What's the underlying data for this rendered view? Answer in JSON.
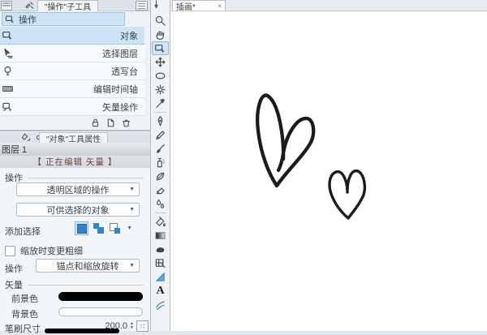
{
  "panel_tabs": {
    "subtool_tab": "\"操作\"子工具",
    "property_tab": "\"对象\"工具属性"
  },
  "subtool": {
    "group_tab": "操作",
    "items": [
      {
        "label": "对象",
        "icon": "object-icon",
        "selected": true
      },
      {
        "label": "选择图层",
        "icon": "select-layer-icon",
        "selected": false
      },
      {
        "label": "透写台",
        "icon": "light-table-icon",
        "selected": false
      },
      {
        "label": "编辑时间轴",
        "icon": "timeline-icon",
        "selected": false
      },
      {
        "label": "矢量操作",
        "icon": "vector-icon",
        "selected": false
      }
    ]
  },
  "property": {
    "layer_name": "图层 1",
    "editing_status": "【 正在编辑 矢量 】",
    "section_operation": "操作",
    "dropdown_transparent_area": "透明区域的操作",
    "dropdown_selectable_objects": "可供选择的对象",
    "add_selection_label": "添加选择",
    "scale_checkbox_label": "缩放时变更粗细",
    "operation_label": "操作",
    "dropdown_anchor_scale": "锚点和缩放旋转",
    "section_vector": "矢量",
    "foreground_label": "前景色",
    "background_label": "背景色",
    "foreground_color": "#000000",
    "background_color": "#ffffff",
    "brush_size_label": "笔刷尺寸",
    "brush_size_value": "200.0"
  },
  "toolbar": {
    "selected_tool": "operation-tool",
    "tools": [
      {
        "name": "zoom-tool",
        "icon": "magnifier-icon"
      },
      {
        "name": "hand-tool",
        "icon": "hand-icon"
      },
      {
        "name": "operation-tool",
        "icon": "object-icon"
      },
      {
        "name": "layer-move-tool",
        "icon": "move-icon"
      },
      {
        "name": "selection-tool",
        "icon": "ellipse-select-icon"
      },
      {
        "name": "auto-select-tool",
        "icon": "magic-wand-icon"
      },
      {
        "name": "eyedropper-tool",
        "icon": "eyedropper-icon"
      },
      {
        "name": "pen-tool",
        "icon": "pen-icon"
      },
      {
        "name": "pencil-tool",
        "icon": "pencil-icon"
      },
      {
        "name": "brush-tool",
        "icon": "brush-icon"
      },
      {
        "name": "airbrush-tool",
        "icon": "airbrush-icon"
      },
      {
        "name": "decoration-tool",
        "icon": "decoration-icon"
      },
      {
        "name": "eraser-tool",
        "icon": "eraser-icon"
      },
      {
        "name": "blend-tool",
        "icon": "blend-icon"
      },
      {
        "name": "fill-tool",
        "icon": "bucket-icon"
      },
      {
        "name": "gradient-tool",
        "icon": "gradient-icon"
      },
      {
        "name": "figure-tool",
        "icon": "figure-icon"
      },
      {
        "name": "frame-border-tool",
        "icon": "frame-icon"
      },
      {
        "name": "ruler-tool",
        "icon": "ruler-icon"
      },
      {
        "name": "text-tool",
        "icon": "text-icon"
      },
      {
        "name": "material-tool",
        "icon": "material-icon"
      }
    ]
  },
  "canvas": {
    "tab_label": "插画*",
    "close_glyph": "×",
    "drawing_description": "two hand-drawn ink hearts"
  }
}
